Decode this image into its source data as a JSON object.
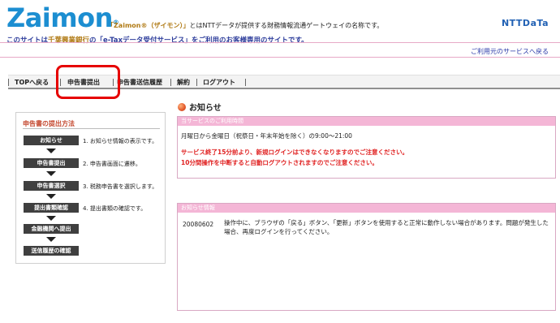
{
  "header": {
    "logo_text": "Zaimon",
    "logo_mark": "®",
    "tagline_zaimon": "「Zaimon®（ザイモン）」",
    "tagline_rest": "とはNTTデータが提供する財務情報流通ゲートウェイの名称です。",
    "ntt_logo": "NTTDaTa",
    "subtitle_pre": "このサイトは",
    "subtitle_bank": "千葉興業銀行",
    "subtitle_post": "の「e-Taxデータ受付サービス」をご利用のお客様専用のサイトです。",
    "user_link": "ご利用元のサービスへ戻る"
  },
  "nav": {
    "items": [
      "TOPへ戻る",
      "申告書提出",
      "申告書送信履歴",
      "解約",
      "ログアウト"
    ]
  },
  "sidebar": {
    "title": "申告書の提出方法",
    "steps": [
      {
        "label": "お知らせ",
        "desc": "1. お知らせ情報の表示です。"
      },
      {
        "label": "申告書提出",
        "desc": "2. 申告書画面に遷移。"
      },
      {
        "label": "申告書選択",
        "desc": "3. 税務申告書を選択します。"
      },
      {
        "label": "提出書類確認",
        "desc": "4. 提出書類の確認です。"
      },
      {
        "label": "金融機関へ提出",
        "desc": ""
      },
      {
        "label": "送信履歴の確認",
        "desc": ""
      }
    ]
  },
  "main": {
    "heading": "お知らせ",
    "service_hours": {
      "title": "当サービスのご利用時間",
      "hours": "月曜日から金曜日（祝祭日・年末年始を除く）の9:00～21:00",
      "warning1": "サービス終了15分前より、新規ログインはできなくなりますのでご注意ください。",
      "warning2": "10分間操作を中断すると自動ログアウトされますのでご注意ください。"
    },
    "news": {
      "title": "お知らせ情報",
      "items": [
        {
          "date": "20080602",
          "text": "操作中に、ブラウザの「戻る」ボタン、「更新」ボタンを使用すると正常に動作しない場合があります。問題が発生した場合、再度ログインを行ってください。"
        }
      ]
    }
  },
  "colors": {
    "accent_blue": "#1c8ed1",
    "highlight_red": "#e60000",
    "panel_pink": "#f4b6d6",
    "warning_red": "#e02222"
  }
}
